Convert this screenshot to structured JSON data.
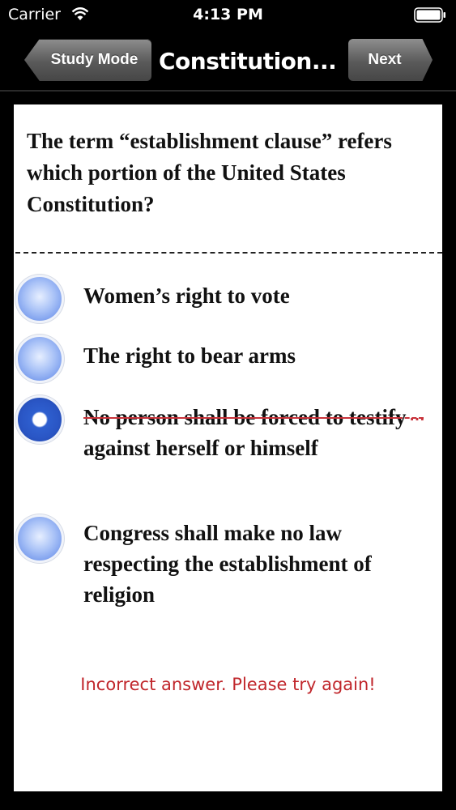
{
  "status_bar": {
    "carrier": "Carrier",
    "time": "4:13 PM"
  },
  "nav": {
    "back_label": "Study Mode",
    "title": "Constitution...",
    "next_label": "Next"
  },
  "quiz": {
    "question": "The term “establishment clause” refers which portion of the United States Constitution?",
    "options": [
      {
        "text": "Women’s right to vote",
        "selected": false,
        "struck_out": false
      },
      {
        "text": "The right to bear arms",
        "selected": false,
        "struck_out": false
      },
      {
        "text": "No person shall be forced to testify against herself or himself",
        "selected": true,
        "struck_out": true
      },
      {
        "text": "Congress shall make no law respecting the establishment of religion",
        "selected": false,
        "struck_out": false
      }
    ],
    "feedback": "Incorrect answer. Please try again!"
  },
  "colors": {
    "feedback": "#c0262b",
    "strike": "#c8323a",
    "radio": "#7ea0ee"
  }
}
